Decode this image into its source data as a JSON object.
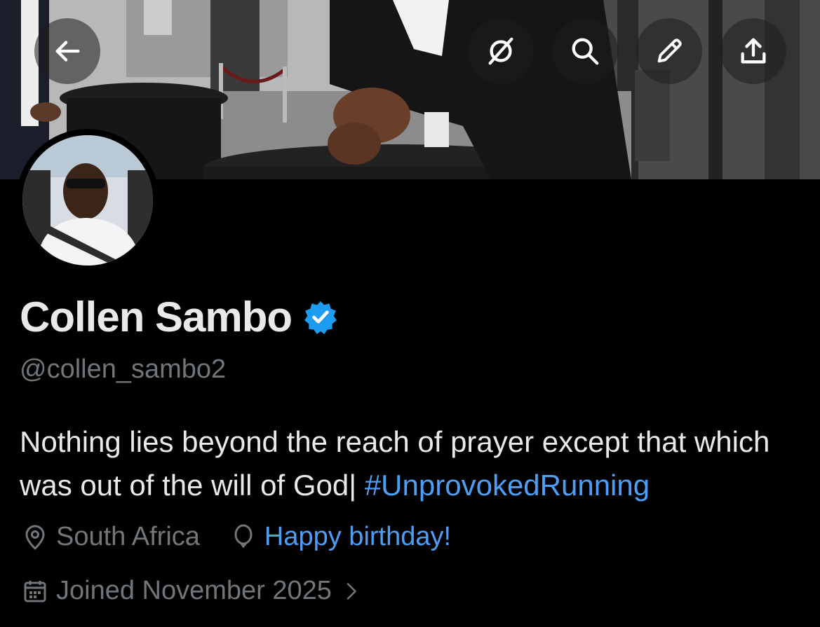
{
  "header": {
    "back_icon": "arrow-left-icon",
    "actions": [
      "grok-icon",
      "search-icon",
      "edit-icon",
      "share-icon"
    ]
  },
  "profile": {
    "name": "Collen Sambo",
    "verified": true,
    "handle": "@collen_sambo2",
    "bio_text": "Nothing lies beyond the reach of prayer except that which was out of the will of God|",
    "bio_hashtag": "#UnprovokedRunning",
    "location": "South Africa",
    "birthday": "Happy birthday!",
    "joined": "Joined November 2025"
  },
  "colors": {
    "background": "#000000",
    "text_primary": "#e7e9ea",
    "text_secondary": "#71767b",
    "accent": "#4e9ef5",
    "verified_badge": "#1d9bf0"
  }
}
